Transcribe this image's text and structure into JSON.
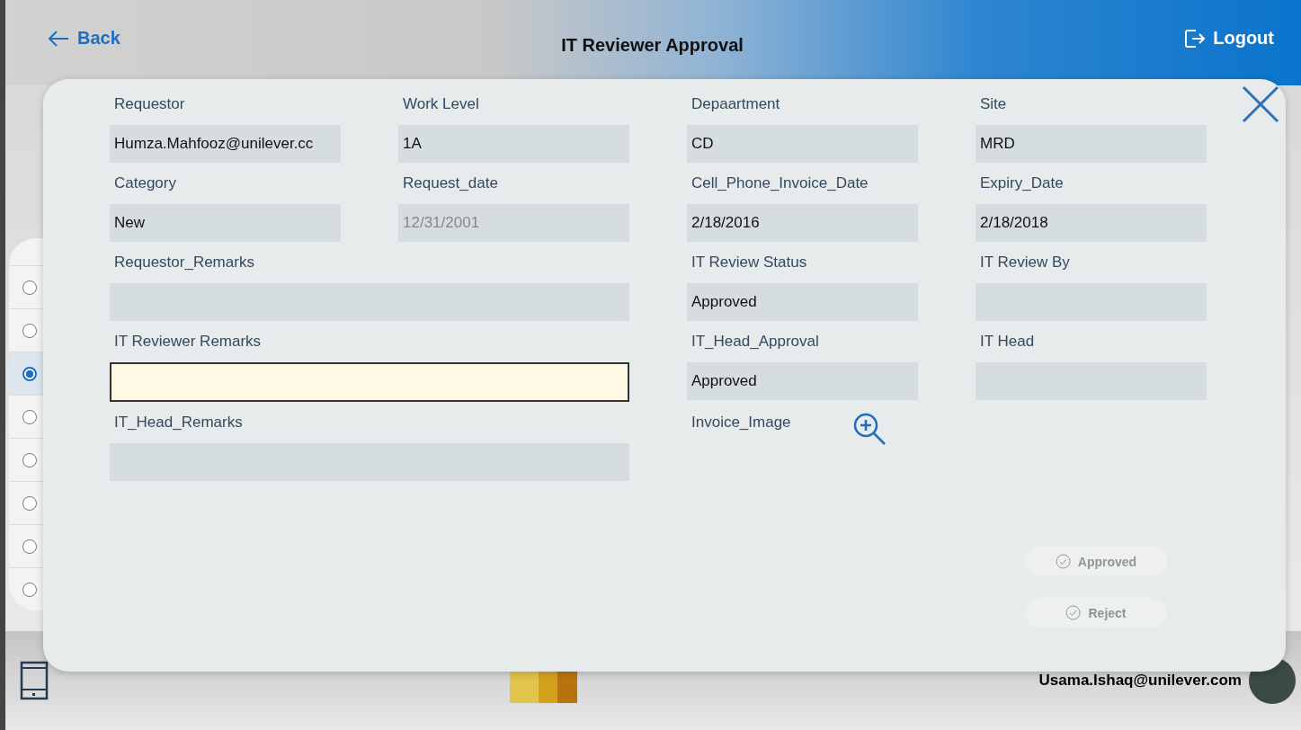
{
  "header": {
    "back": "Back",
    "title": "IT Reviewer Approval",
    "logout": "Logout"
  },
  "list": {
    "rows": [
      {
        "selected": false
      },
      {
        "selected": false
      },
      {
        "selected": true
      },
      {
        "selected": false
      },
      {
        "selected": false
      },
      {
        "selected": false
      },
      {
        "selected": false
      },
      {
        "selected": false
      }
    ]
  },
  "footer": {
    "user_email": "Usama.Ishaq@unilever.com"
  },
  "dialog": {
    "fields": [
      {
        "label": "Requestor",
        "value": "Humza.Mahfooz@unilever.cc",
        "kind": "text"
      },
      {
        "label": "Work Level",
        "value": "1A",
        "kind": "text"
      },
      {
        "label": "Depaartment",
        "value": "CD",
        "kind": "text"
      },
      {
        "label": "Site",
        "value": "MRD",
        "kind": "text"
      },
      {
        "label": "Category",
        "value": "New",
        "kind": "text"
      },
      {
        "label": "Request_date",
        "value": "12/31/2001",
        "kind": "disabled"
      },
      {
        "label": "Cell_Phone_Invoice_Date",
        "value": "2/18/2016",
        "kind": "text"
      },
      {
        "label": "Expiry_Date",
        "value": "2/18/2018",
        "kind": "text"
      },
      {
        "label": "Requestor_Remarks",
        "kind": "wide"
      },
      {
        "label": "IT Review Status",
        "value": "Approved",
        "kind": "text"
      },
      {
        "label": "IT Review By",
        "kind": "text"
      },
      {
        "label": "IT Reviewer Remarks",
        "kind": "editable"
      },
      {
        "label": "IT_Head_Approval",
        "value": "Approved",
        "kind": "text"
      },
      {
        "label": "IT Head",
        "kind": "text"
      },
      {
        "label": "IT_Head_Remarks",
        "kind": "wide"
      },
      {
        "label": "Invoice_Image",
        "kind": "image"
      }
    ],
    "buttons": [
      {
        "label": "Approved",
        "disabled": true
      },
      {
        "label": "Reject",
        "disabled": true
      }
    ]
  }
}
